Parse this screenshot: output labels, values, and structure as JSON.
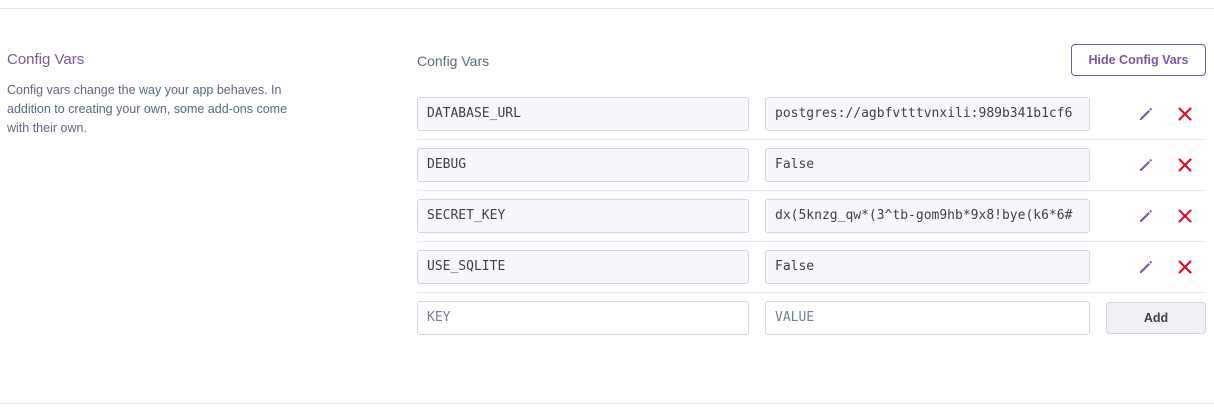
{
  "sidebar": {
    "title": "Config Vars",
    "description": "Config vars change the way your app behaves. In addition to creating your own, some add-ons come with their own."
  },
  "main": {
    "title": "Config Vars",
    "hide_button": "Hide Config Vars",
    "vars": [
      {
        "key": "DATABASE_URL",
        "value": "postgres://agbfvtttvnxili:989b341b1cf6"
      },
      {
        "key": "DEBUG",
        "value": "False"
      },
      {
        "key": "SECRET_KEY",
        "value": "dx(5knzg_qw*(3^tb-gom9hb*9x8!bye(k6*6#"
      },
      {
        "key": "USE_SQLITE",
        "value": "False"
      }
    ],
    "new_var": {
      "key_placeholder": "KEY",
      "value_placeholder": "VALUE",
      "add_button": "Add"
    }
  },
  "colors": {
    "accent": "#79589f",
    "delete": "#d5122a",
    "muted_text": "#596981"
  },
  "icons": {
    "edit": "pencil-icon",
    "delete": "x-icon"
  }
}
